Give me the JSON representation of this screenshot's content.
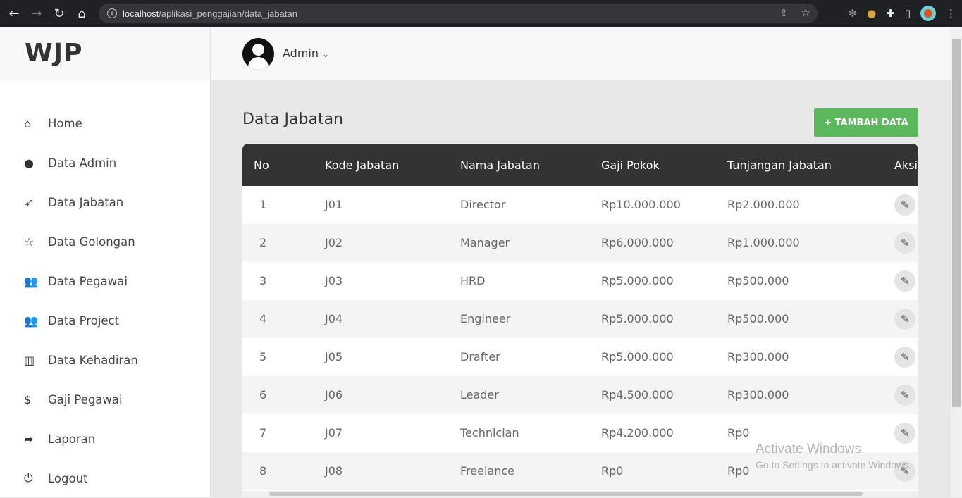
{
  "browser": {
    "url_host": "localhost",
    "url_path": "/aplikasi_penggajian/data_jabatan"
  },
  "sidebar": {
    "brand": "WJP",
    "items": [
      {
        "label": "Home",
        "icon": "home-icon",
        "glyph": "⌂"
      },
      {
        "label": "Data Admin",
        "icon": "user-icon",
        "glyph": "●"
      },
      {
        "label": "Data Jabatan",
        "icon": "rocket-icon",
        "glyph": "➶"
      },
      {
        "label": "Data Golongan",
        "icon": "star-icon",
        "glyph": "☆"
      },
      {
        "label": "Data Pegawai",
        "icon": "users-icon",
        "glyph": "👥"
      },
      {
        "label": "Data Project",
        "icon": "users-icon",
        "glyph": "👥"
      },
      {
        "label": "Data Kehadiran",
        "icon": "bar-chart-icon",
        "glyph": "▥"
      },
      {
        "label": "Gaji Pegawai",
        "icon": "dollar-icon",
        "glyph": "$"
      },
      {
        "label": "Laporan",
        "icon": "share-icon",
        "glyph": "➦"
      },
      {
        "label": "Logout",
        "icon": "power-icon",
        "glyph": "⏻"
      }
    ]
  },
  "header": {
    "user_name": "Admin",
    "dropdown_glyph": "⌄"
  },
  "main": {
    "title": "Data Jabatan",
    "add_button": "+ TAMBAH DATA",
    "columns": [
      "No",
      "Kode Jabatan",
      "Nama Jabatan",
      "Gaji Pokok",
      "Tunjangan Jabatan",
      "Aksi"
    ],
    "rows": [
      [
        "1",
        "J01",
        "Director",
        "Rp10.000.000",
        "Rp2.000.000"
      ],
      [
        "2",
        "J02",
        "Manager",
        "Rp6.000.000",
        "Rp1.000.000"
      ],
      [
        "3",
        "J03",
        "HRD",
        "Rp5.000.000",
        "Rp500.000"
      ],
      [
        "4",
        "J04",
        "Engineer",
        "Rp5.000.000",
        "Rp500.000"
      ],
      [
        "5",
        "J05",
        "Drafter",
        "Rp5.000.000",
        "Rp300.000"
      ],
      [
        "6",
        "J06",
        "Leader",
        "Rp4.500.000",
        "Rp300.000"
      ],
      [
        "7",
        "J07",
        "Technician",
        "Rp4.200.000",
        "Rp0"
      ],
      [
        "8",
        "J08",
        "Freelance",
        "Rp0",
        "Rp0"
      ]
    ]
  },
  "watermark": {
    "line1": "Activate Windows",
    "line2": "Go to Settings to activate Windows."
  },
  "colors": {
    "header_bg": "#333333",
    "add_button": "#5cb85c"
  }
}
